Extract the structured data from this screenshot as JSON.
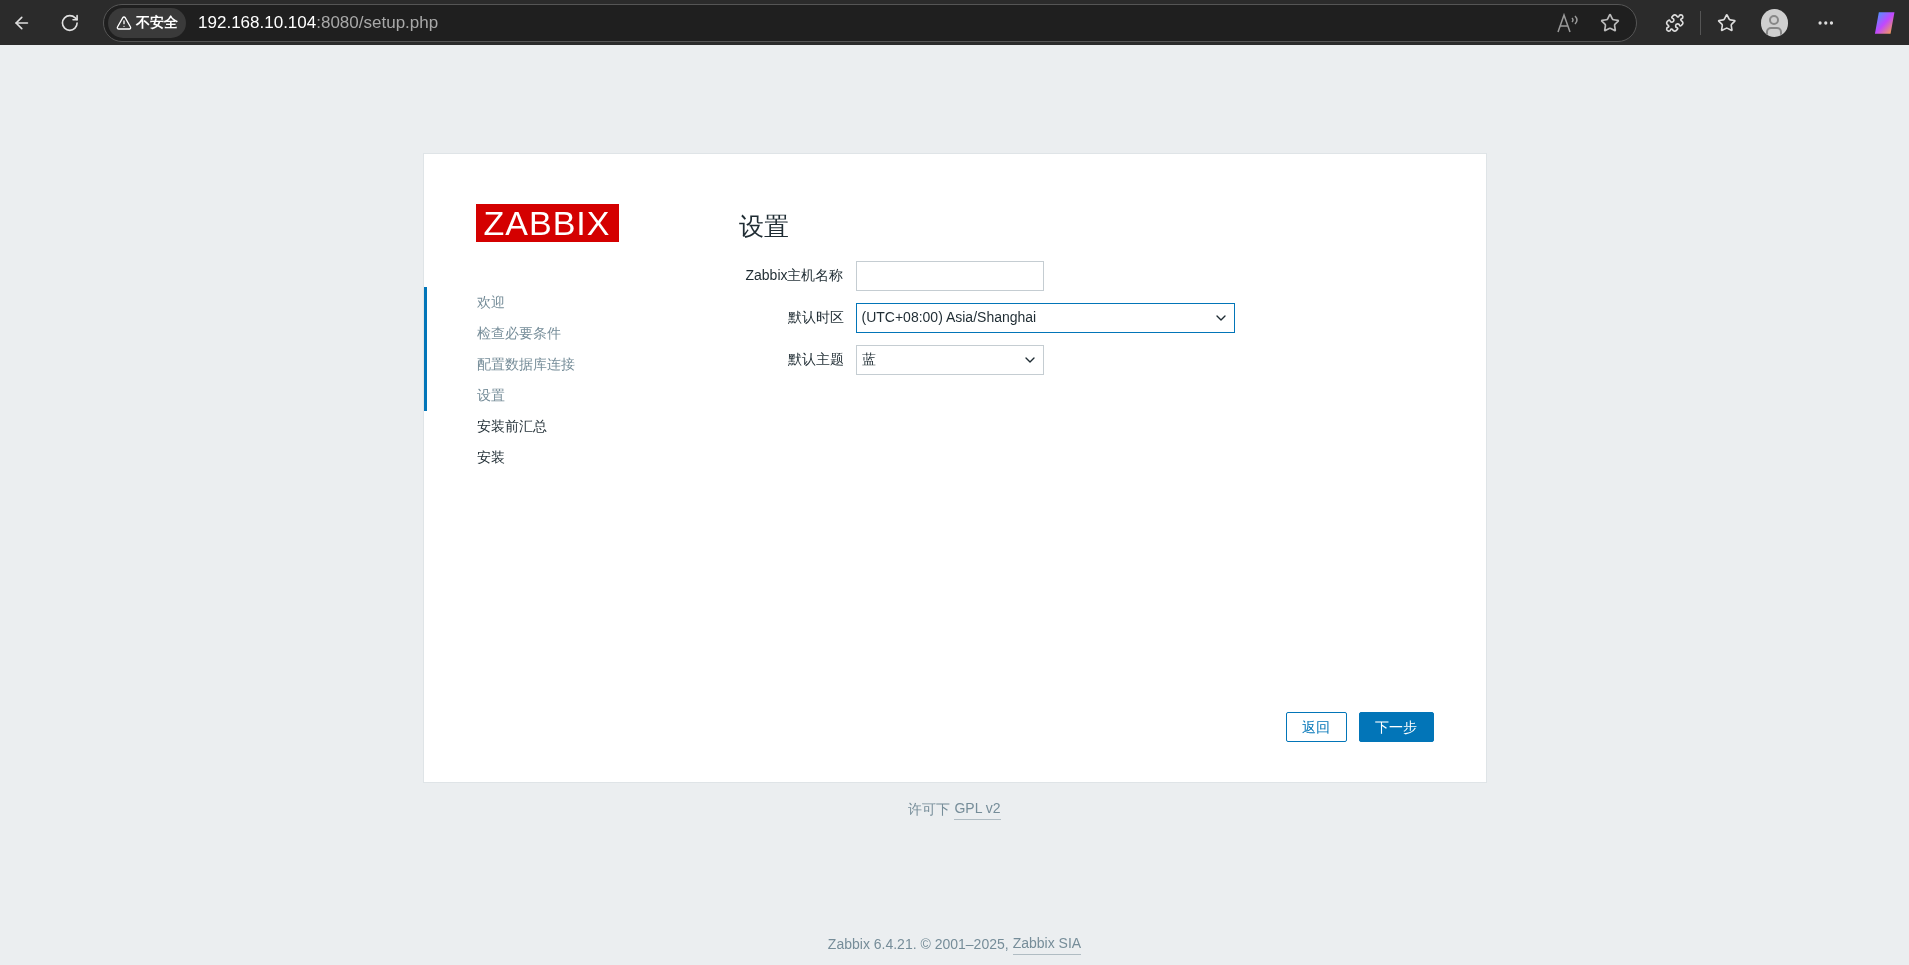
{
  "browser": {
    "security_label": "不安全",
    "url_host": "192.168.10.104",
    "url_rest": ":8080/setup.php"
  },
  "logo": "ZABBIX",
  "steps": [
    {
      "label": "欢迎",
      "completed": true
    },
    {
      "label": "检查必要条件",
      "completed": true
    },
    {
      "label": "配置数据库连接",
      "completed": true
    },
    {
      "label": "设置",
      "completed": true
    },
    {
      "label": "安装前汇总",
      "completed": false
    },
    {
      "label": "安装",
      "completed": false
    }
  ],
  "title": "设置",
  "fields": [
    {
      "kind": "text",
      "label": "Zabbix主机名称",
      "focused": false
    },
    {
      "kind": "select",
      "label": "默认时区",
      "value": "(UTC+08:00) Asia/Shanghai",
      "focused": true
    },
    {
      "kind": "select",
      "label": "默认主题",
      "value": "蓝",
      "focused": false
    }
  ],
  "buttons": [
    {
      "label": "返回",
      "kind": "secondary"
    },
    {
      "label": "下一步",
      "kind": "primary"
    }
  ],
  "license": {
    "text": "许可下",
    "link": "GPL v2"
  },
  "footer": {
    "text": "Zabbix 6.4.21. © 2001–2025,",
    "link": "Zabbix SIA"
  }
}
